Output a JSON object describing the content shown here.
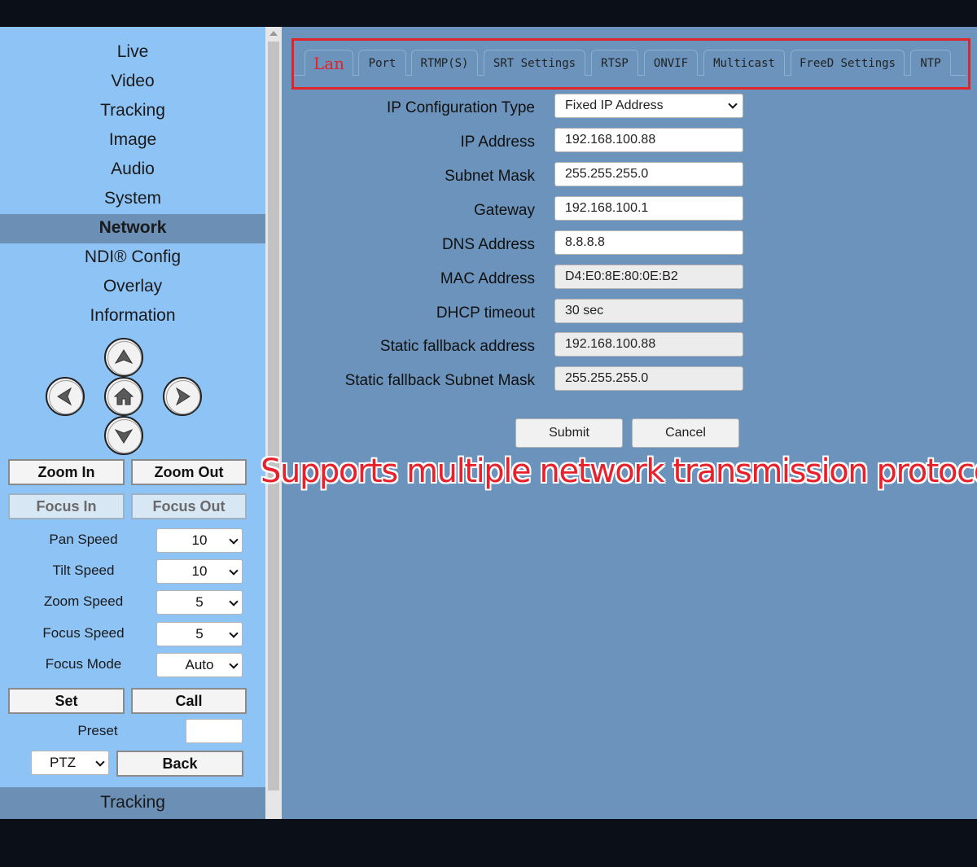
{
  "sidebar": {
    "menu": [
      {
        "label": "Live",
        "active": false
      },
      {
        "label": "Video",
        "active": false
      },
      {
        "label": "Tracking",
        "active": false
      },
      {
        "label": "Image",
        "active": false
      },
      {
        "label": "Audio",
        "active": false
      },
      {
        "label": "System",
        "active": false
      },
      {
        "label": "Network",
        "active": true
      },
      {
        "label": "NDI® Config",
        "active": false
      },
      {
        "label": "Overlay",
        "active": false
      },
      {
        "label": "Information",
        "active": false
      }
    ],
    "ptz": {
      "zoom_in": "Zoom In",
      "zoom_out": "Zoom Out",
      "focus_in": "Focus In",
      "focus_out": "Focus Out",
      "pan_speed": {
        "label": "Pan Speed",
        "value": "10"
      },
      "tilt_speed": {
        "label": "Tilt Speed",
        "value": "10"
      },
      "zoom_speed": {
        "label": "Zoom Speed",
        "value": "5"
      },
      "focus_speed": {
        "label": "Focus Speed",
        "value": "5"
      },
      "focus_mode": {
        "label": "Focus Mode",
        "value": "Auto"
      },
      "set": "Set",
      "call": "Call",
      "preset_label": "Preset",
      "preset_value": "",
      "mode": "PTZ",
      "back": "Back"
    },
    "bottom_tab": "Tracking"
  },
  "tabs": [
    "Lan",
    "Port",
    "RTMP(S)",
    "SRT Settings",
    "RTSP",
    "ONVIF",
    "Multicast",
    "FreeD Settings",
    "NTP"
  ],
  "form": {
    "ip_config_type": {
      "label": "IP Configuration Type",
      "value": "Fixed IP Address"
    },
    "ip_address": {
      "label": "IP Address",
      "value": "192.168.100.88"
    },
    "subnet_mask": {
      "label": "Subnet Mask",
      "value": "255.255.255.0"
    },
    "gateway": {
      "label": "Gateway",
      "value": "192.168.100.1"
    },
    "dns": {
      "label": "DNS Address",
      "value": "8.8.8.8"
    },
    "mac": {
      "label": "MAC Address",
      "value": "D4:E0:8E:80:0E:B2"
    },
    "dhcp_timeout": {
      "label": "DHCP timeout",
      "value": "30 sec"
    },
    "static_fallback_address": {
      "label": "Static fallback address",
      "value": "192.168.100.88"
    },
    "static_fallback_mask": {
      "label": "Static fallback Subnet Mask",
      "value": "255.255.255.0"
    },
    "submit": "Submit",
    "cancel": "Cancel"
  },
  "banner": "Supports multiple network transmission protocols",
  "colors": {
    "sidebar": "#8ec3f5",
    "main": "#6b93bb",
    "active_menu": "#6b8fb5",
    "accent_red": "#e0242a"
  }
}
